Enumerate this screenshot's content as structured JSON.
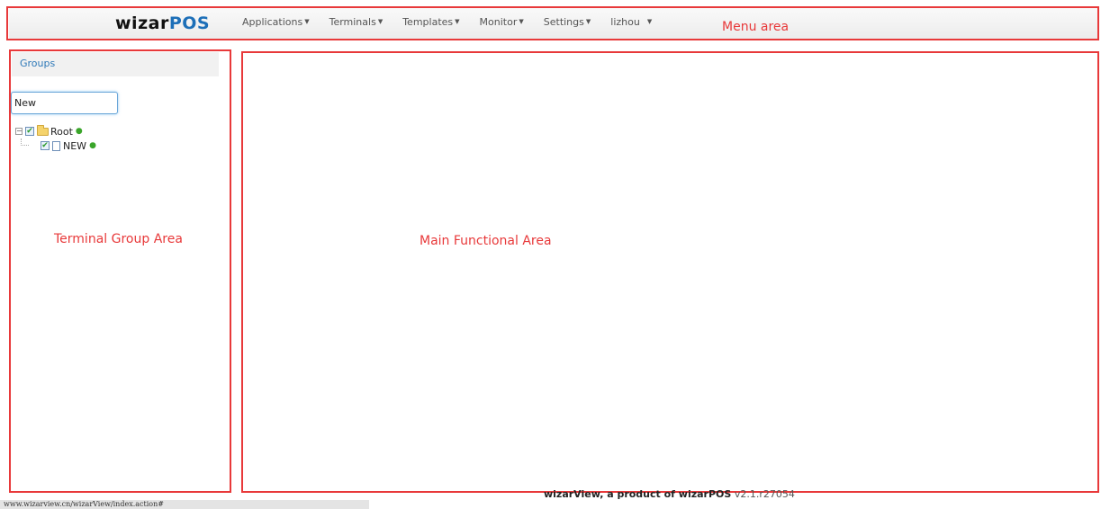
{
  "header": {
    "brand_main": "wizar",
    "brand_accent": "POS",
    "menu": [
      {
        "label": "Applications"
      },
      {
        "label": "Terminals"
      },
      {
        "label": "Templates"
      },
      {
        "label": "Monitor"
      },
      {
        "label": "Settings"
      },
      {
        "label": "lizhou"
      }
    ]
  },
  "annotations": {
    "menu_area": "Menu area",
    "terminal_group_area": "Terminal Group Area",
    "main_functional_area": "Main Functional Area"
  },
  "sidebar": {
    "title": "Groups",
    "search_value": "New",
    "tree": [
      {
        "label": "Root",
        "checked": true,
        "icon": "folder-icon",
        "level": 0
      },
      {
        "label": "NEW",
        "checked": true,
        "icon": "document-icon",
        "level": 1
      }
    ]
  },
  "footer": {
    "product": "wizarView, a product of wizarPOS",
    "version": "v2.1.r27054"
  },
  "statusbar": {
    "url": "www.wizarview.cn/wizarView/index.action#"
  },
  "colors": {
    "annotation": "#e8393a",
    "brand_accent": "#1d6fb8",
    "link": "#2f79b8"
  }
}
